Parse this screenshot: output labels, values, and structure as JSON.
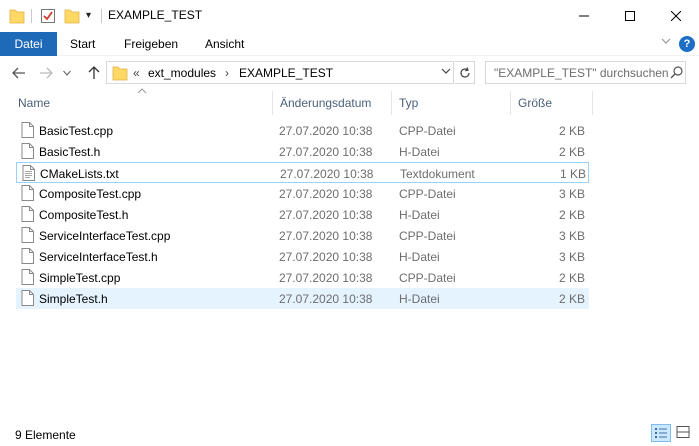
{
  "window": {
    "title": "EXAMPLE_TEST",
    "quick_access_icons": [
      "folder-icon",
      "properties-icon",
      "new-folder-icon"
    ],
    "controls": [
      "minimize",
      "maximize",
      "close"
    ]
  },
  "ribbon": {
    "tabs": [
      {
        "label": "Datei",
        "active": true
      },
      {
        "label": "Start"
      },
      {
        "label": "Freigeben"
      },
      {
        "label": "Ansicht"
      }
    ],
    "help_label": "?"
  },
  "address": {
    "overflow": "«",
    "path": [
      "ext_modules",
      "EXAMPLE_TEST"
    ]
  },
  "search": {
    "placeholder": "\"EXAMPLE_TEST\" durchsuchen"
  },
  "columns": {
    "name": "Name",
    "date": "Änderungsdatum",
    "type": "Typ",
    "size": "Größe"
  },
  "files": [
    {
      "name": "BasicTest.cpp",
      "date": "27.07.2020 10:38",
      "type": "CPP-Datei",
      "size": "2 KB",
      "icon": "file-icon"
    },
    {
      "name": "BasicTest.h",
      "date": "27.07.2020 10:38",
      "type": "H-Datei",
      "size": "2 KB",
      "icon": "file-icon"
    },
    {
      "name": "CMakeLists.txt",
      "date": "27.07.2020 10:38",
      "type": "Textdokument",
      "size": "1 KB",
      "icon": "text-file-icon",
      "focused": true
    },
    {
      "name": "CompositeTest.cpp",
      "date": "27.07.2020 10:38",
      "type": "CPP-Datei",
      "size": "3 KB",
      "icon": "file-icon"
    },
    {
      "name": "CompositeTest.h",
      "date": "27.07.2020 10:38",
      "type": "H-Datei",
      "size": "2 KB",
      "icon": "file-icon"
    },
    {
      "name": "ServiceInterfaceTest.cpp",
      "date": "27.07.2020 10:38",
      "type": "CPP-Datei",
      "size": "3 KB",
      "icon": "file-icon"
    },
    {
      "name": "ServiceInterfaceTest.h",
      "date": "27.07.2020 10:38",
      "type": "H-Datei",
      "size": "3 KB",
      "icon": "file-icon"
    },
    {
      "name": "SimpleTest.cpp",
      "date": "27.07.2020 10:38",
      "type": "CPP-Datei",
      "size": "2 KB",
      "icon": "file-icon"
    },
    {
      "name": "SimpleTest.h",
      "date": "27.07.2020 10:38",
      "type": "H-Datei",
      "size": "2 KB",
      "icon": "file-icon",
      "selected": true
    }
  ],
  "status": {
    "count_text": "9 Elemente"
  },
  "colors": {
    "file_tab": "#1e6ab8",
    "selection": "#e5f3ff",
    "focus_border": "#99d1ff",
    "header_text": "#4c607a",
    "folder": "#ffd866"
  }
}
